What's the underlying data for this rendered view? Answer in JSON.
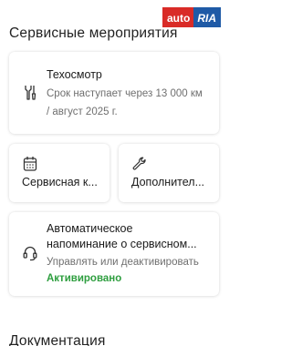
{
  "logo": {
    "auto": "auto",
    "ria": "RIA"
  },
  "sections": {
    "service_title": "Сервисные мероприятия",
    "documents_title": "Документация"
  },
  "inspection_card": {
    "title": "Техосмотр",
    "subtitle": "Срок наступает через 13 000 км / август 2025 г.",
    "icon": "wrench-screwdriver-icon"
  },
  "service_book_card": {
    "title": "Сервисная к...",
    "icon": "calendar-book-icon"
  },
  "additional_card": {
    "title": "Дополнител...",
    "icon": "wrench-icon"
  },
  "reminder_card": {
    "title": "Автоматическое напоминание о сервисном...",
    "subtitle": "Управлять или деактивировать",
    "status": "Активировано",
    "icon": "headset-icon"
  },
  "colors": {
    "logo_auto": "#d92b27",
    "logo_ria": "#1f5aa6",
    "status_active": "#2e9e3f"
  }
}
